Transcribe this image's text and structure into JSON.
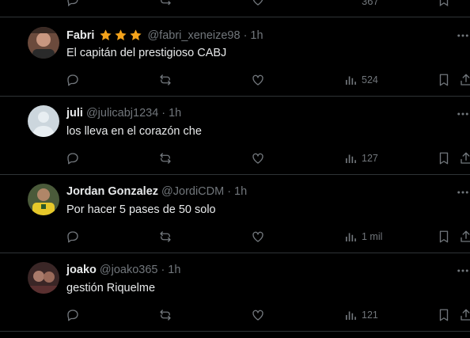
{
  "top_partial": {
    "views_count": "367"
  },
  "tweets": [
    {
      "name": "Fabri",
      "badges": [
        "star-icon",
        "star-icon",
        "star-icon"
      ],
      "handle": "@fabri_xeneize98",
      "dot": "·",
      "time": "1h",
      "text": "El capitán del prestigioso CABJ",
      "views": "524",
      "avatar_color": "#8a5a4a"
    },
    {
      "name": "juli",
      "badges": [],
      "handle": "@julicabj1234",
      "dot": "·",
      "time": "1h",
      "text": "los lleva en el corazón che",
      "views": "127",
      "avatar_color": "#ccd6dd"
    },
    {
      "name": "Jordan Gonzalez",
      "badges": [],
      "handle": "@JordiCDM",
      "dot": "·",
      "time": "1h",
      "text": "Por hacer 5 pases de 50 solo",
      "views": "1 mil",
      "avatar_color": "#d8c43a"
    },
    {
      "name": "joako",
      "badges": [],
      "handle": "@joako365",
      "dot": "·",
      "time": "1h",
      "text": "gestión Riquelme",
      "views": "121",
      "avatar_color": "#5a3a3a"
    }
  ],
  "colors": {
    "background": "#000000",
    "text": "#e7e9ea",
    "muted": "#71767b",
    "divider": "#2f3336",
    "star": "#f4a31b"
  }
}
